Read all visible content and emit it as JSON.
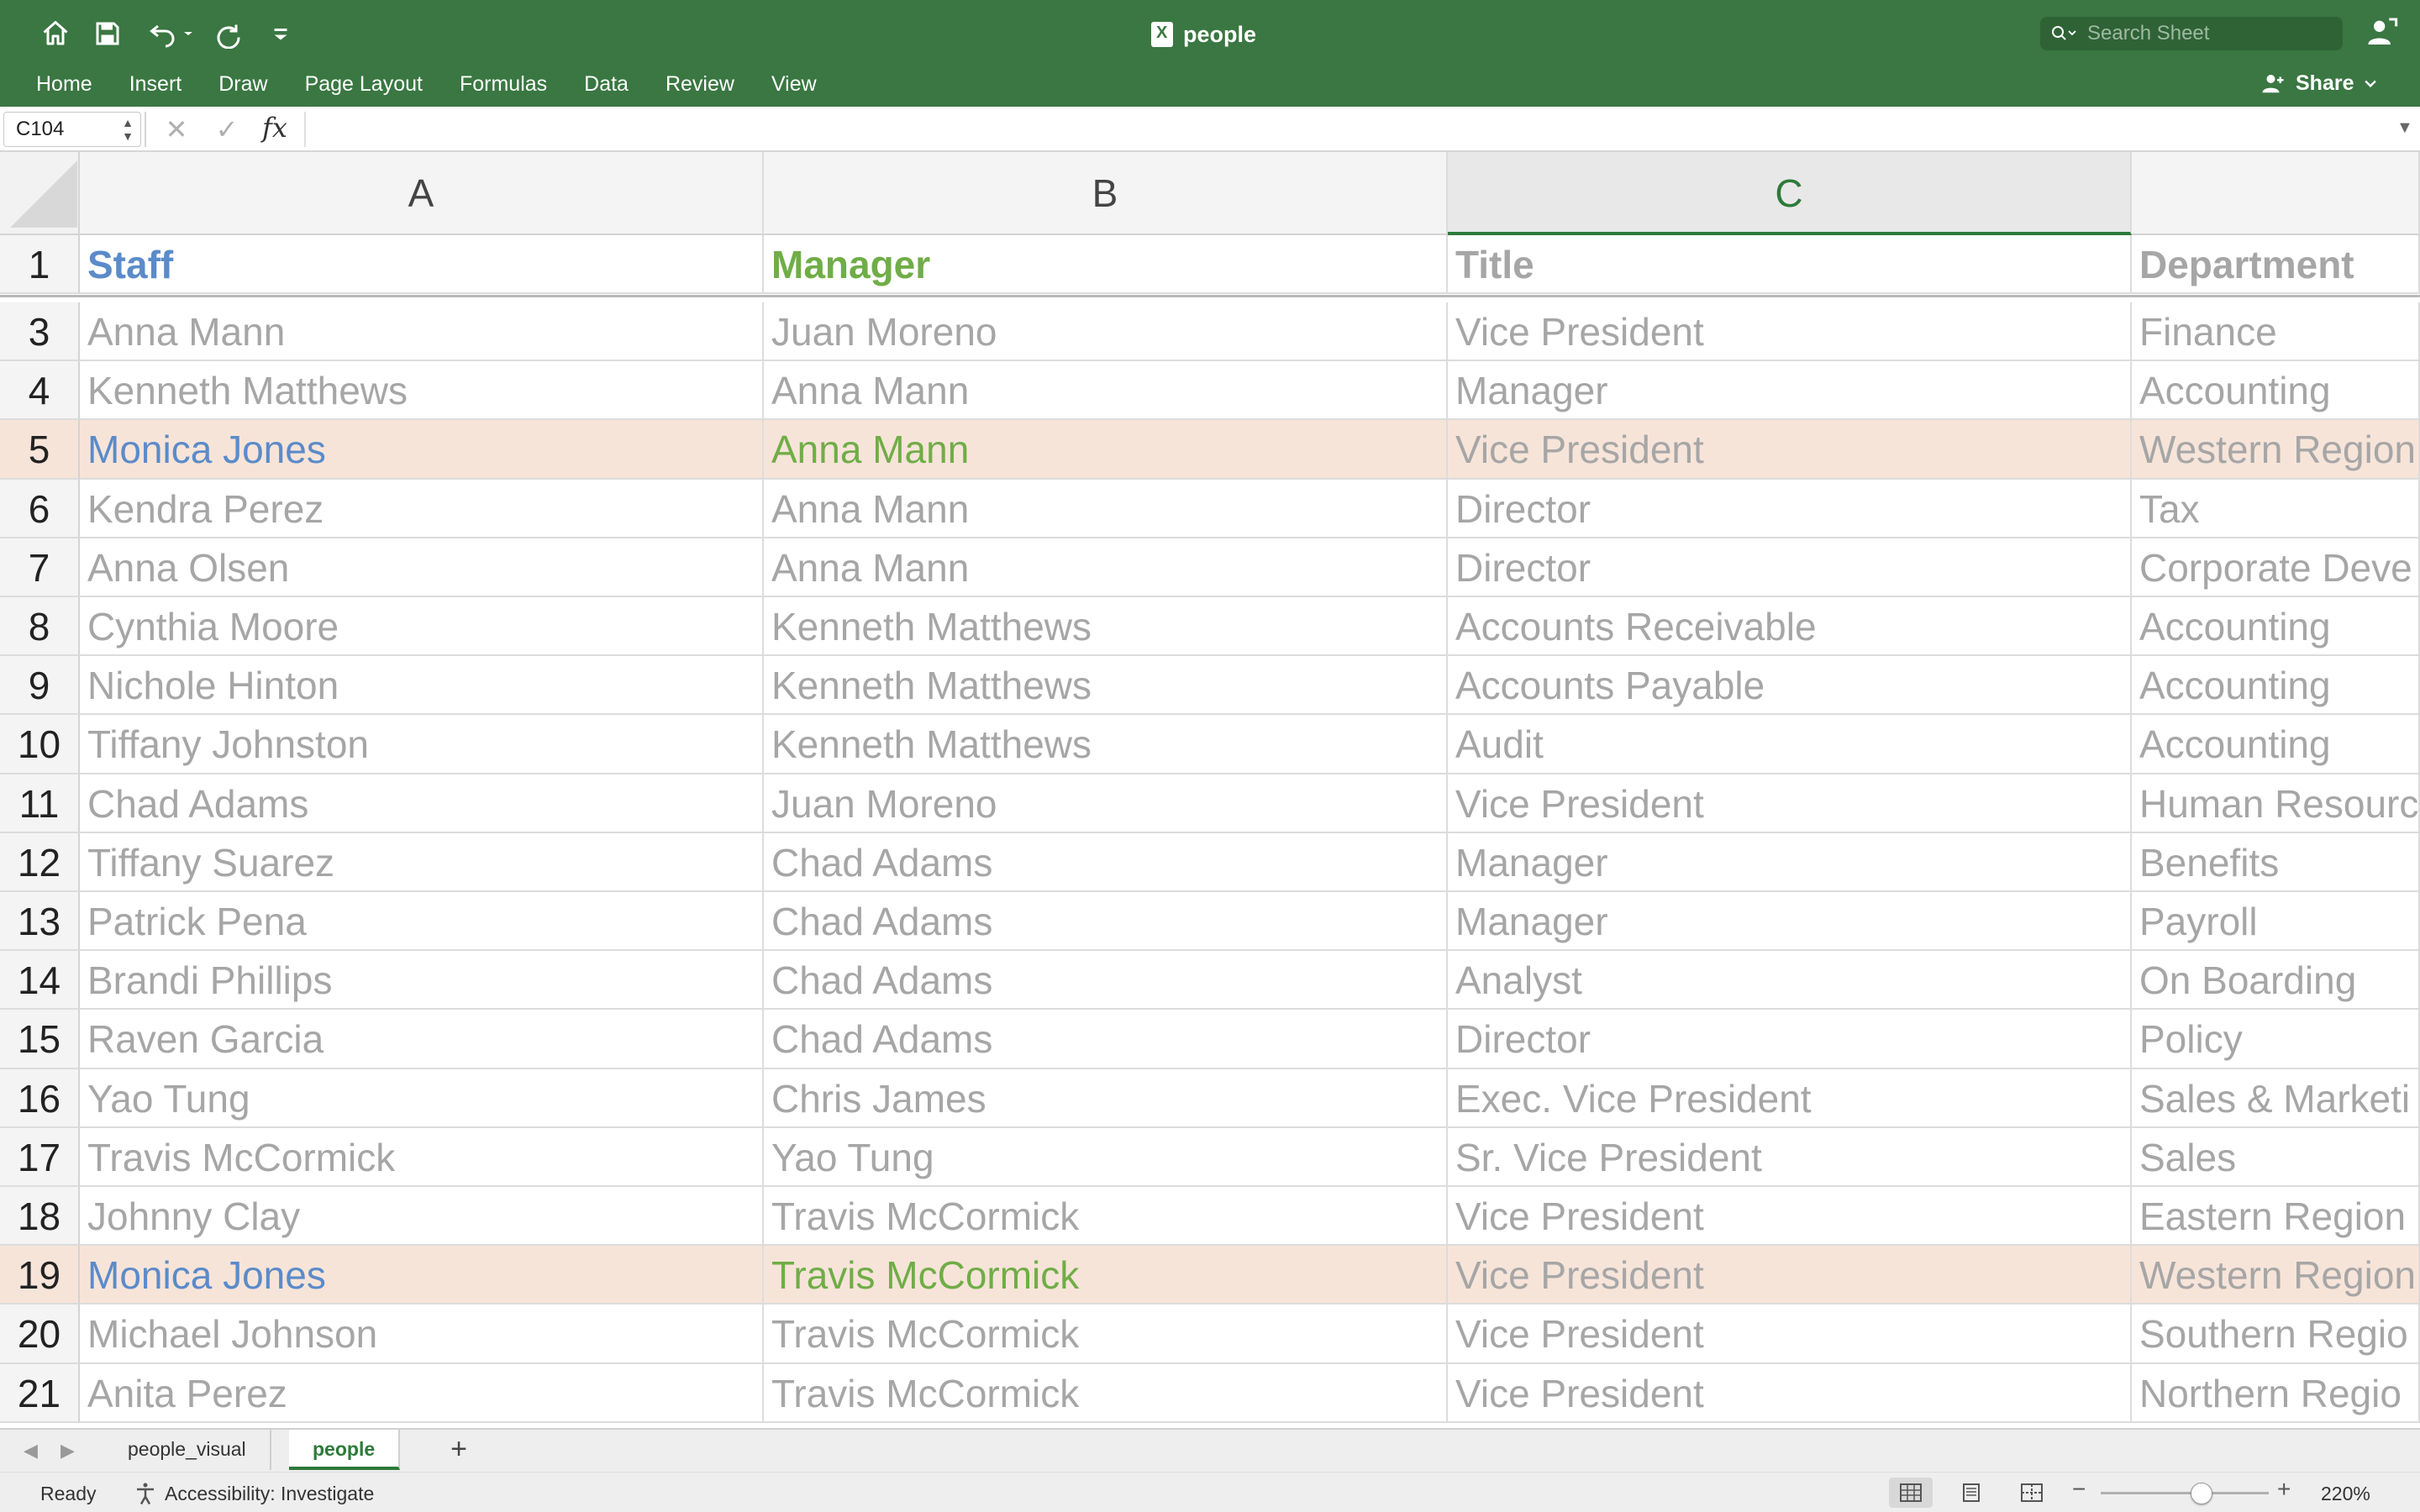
{
  "window": {
    "title": "people",
    "search_placeholder": "Search Sheet"
  },
  "ribbon": {
    "tabs": [
      "Home",
      "Insert",
      "Draw",
      "Page Layout",
      "Formulas",
      "Data",
      "Review",
      "View"
    ],
    "share_label": "Share"
  },
  "formula_bar": {
    "name_box": "C104",
    "formula": "",
    "fx_label": "fx"
  },
  "grid": {
    "columns": [
      "A",
      "B",
      "C"
    ],
    "selected_column": "C",
    "header_row": {
      "row": "1",
      "cells": [
        "Staff",
        "Manager",
        "Title",
        "Department"
      ]
    },
    "rows": [
      {
        "row": "3",
        "cells": [
          "Anna Mann",
          "Juan Moreno",
          "Vice President",
          "Finance"
        ],
        "highlight": false
      },
      {
        "row": "4",
        "cells": [
          "Kenneth Matthews",
          "Anna Mann",
          "Manager",
          "Accounting"
        ],
        "highlight": false
      },
      {
        "row": "5",
        "cells": [
          "Monica Jones",
          "Anna Mann",
          "Vice President",
          "Western Region"
        ],
        "highlight": true
      },
      {
        "row": "6",
        "cells": [
          "Kendra Perez",
          "Anna Mann",
          "Director",
          "Tax"
        ],
        "highlight": false
      },
      {
        "row": "7",
        "cells": [
          "Anna Olsen",
          "Anna Mann",
          "Director",
          "Corporate Deve"
        ],
        "highlight": false
      },
      {
        "row": "8",
        "cells": [
          "Cynthia Moore",
          "Kenneth Matthews",
          "Accounts Receivable",
          "Accounting"
        ],
        "highlight": false
      },
      {
        "row": "9",
        "cells": [
          "Nichole Hinton",
          "Kenneth Matthews",
          "Accounts Payable",
          "Accounting"
        ],
        "highlight": false
      },
      {
        "row": "10",
        "cells": [
          "Tiffany Johnston",
          "Kenneth Matthews",
          "Audit",
          "Accounting"
        ],
        "highlight": false
      },
      {
        "row": "11",
        "cells": [
          "Chad Adams",
          "Juan Moreno",
          "Vice President",
          "Human Resourc"
        ],
        "highlight": false
      },
      {
        "row": "12",
        "cells": [
          "Tiffany Suarez",
          "Chad Adams",
          "Manager",
          "Benefits"
        ],
        "highlight": false
      },
      {
        "row": "13",
        "cells": [
          "Patrick Pena",
          "Chad Adams",
          "Manager",
          "Payroll"
        ],
        "highlight": false
      },
      {
        "row": "14",
        "cells": [
          "Brandi Phillips",
          "Chad Adams",
          "Analyst",
          "On Boarding"
        ],
        "highlight": false
      },
      {
        "row": "15",
        "cells": [
          "Raven Garcia",
          "Chad Adams",
          "Director",
          "Policy"
        ],
        "highlight": false
      },
      {
        "row": "16",
        "cells": [
          "Yao Tung",
          "Chris James",
          "Exec. Vice President",
          "Sales & Marketi"
        ],
        "highlight": false
      },
      {
        "row": "17",
        "cells": [
          "Travis McCormick",
          "Yao Tung",
          "Sr. Vice President",
          "Sales"
        ],
        "highlight": false
      },
      {
        "row": "18",
        "cells": [
          "Johnny Clay",
          "Travis McCormick",
          "Vice President",
          "Eastern Region"
        ],
        "highlight": false
      },
      {
        "row": "19",
        "cells": [
          "Monica Jones",
          "Travis McCormick",
          "Vice President",
          "Western Region"
        ],
        "highlight": true
      },
      {
        "row": "20",
        "cells": [
          "Michael Johnson",
          "Travis McCormick",
          "Vice President",
          "Southern Regio"
        ],
        "highlight": false
      },
      {
        "row": "21",
        "cells": [
          "Anita Perez",
          "Travis McCormick",
          "Vice President",
          "Northern Regio"
        ],
        "highlight": false
      }
    ]
  },
  "sheets": {
    "tabs": [
      "people_visual",
      "people"
    ],
    "active": "people",
    "add_label": "+"
  },
  "status": {
    "ready": "Ready",
    "accessibility": "Accessibility: Investigate",
    "zoom": "220%",
    "zoom_fraction": 0.6
  },
  "colors": {
    "ribbon": "#3a7742",
    "accent": "#2d7a3a",
    "staff_text": "#5b8bc9",
    "manager_text": "#70ad47",
    "muted_text": "#a6a6a6",
    "highlight_row": "#f7e4d9"
  },
  "icons": [
    "home-icon",
    "save-icon",
    "undo-icon",
    "redo-icon",
    "customize-toolbar-icon",
    "excel-file-icon",
    "search-icon",
    "profile-icon",
    "share-icon",
    "chevron-down-icon"
  ]
}
